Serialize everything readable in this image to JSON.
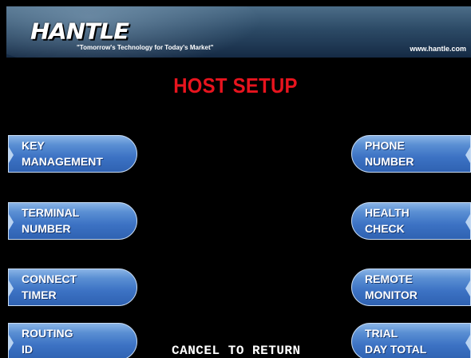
{
  "header": {
    "logo_text": "HANTLE",
    "tagline": "\"Tomorrow's Technology for Today's Market\"",
    "website": "www.hantle.com"
  },
  "screen_title": "HOST SETUP",
  "left_keys": [
    {
      "line1": "KEY",
      "line2": "MANAGEMENT"
    },
    {
      "line1": "TERMINAL",
      "line2": "NUMBER"
    },
    {
      "line1": "CONNECT",
      "line2": "TIMER"
    },
    {
      "line1": "ROUTING",
      "line2": "ID"
    }
  ],
  "right_keys": [
    {
      "line1": "PHONE",
      "line2": "NUMBER"
    },
    {
      "line1": "HEALTH",
      "line2": "CHECK"
    },
    {
      "line1": "REMOTE",
      "line2": "MONITOR"
    },
    {
      "line1": "TRIAL",
      "line2": "DAY TOTAL"
    }
  ],
  "cancel_text": "CANCEL TO RETURN",
  "colors": {
    "background": "#000000",
    "title": "#e8141e",
    "button": "#3c72c4",
    "text": "#ffffff"
  }
}
